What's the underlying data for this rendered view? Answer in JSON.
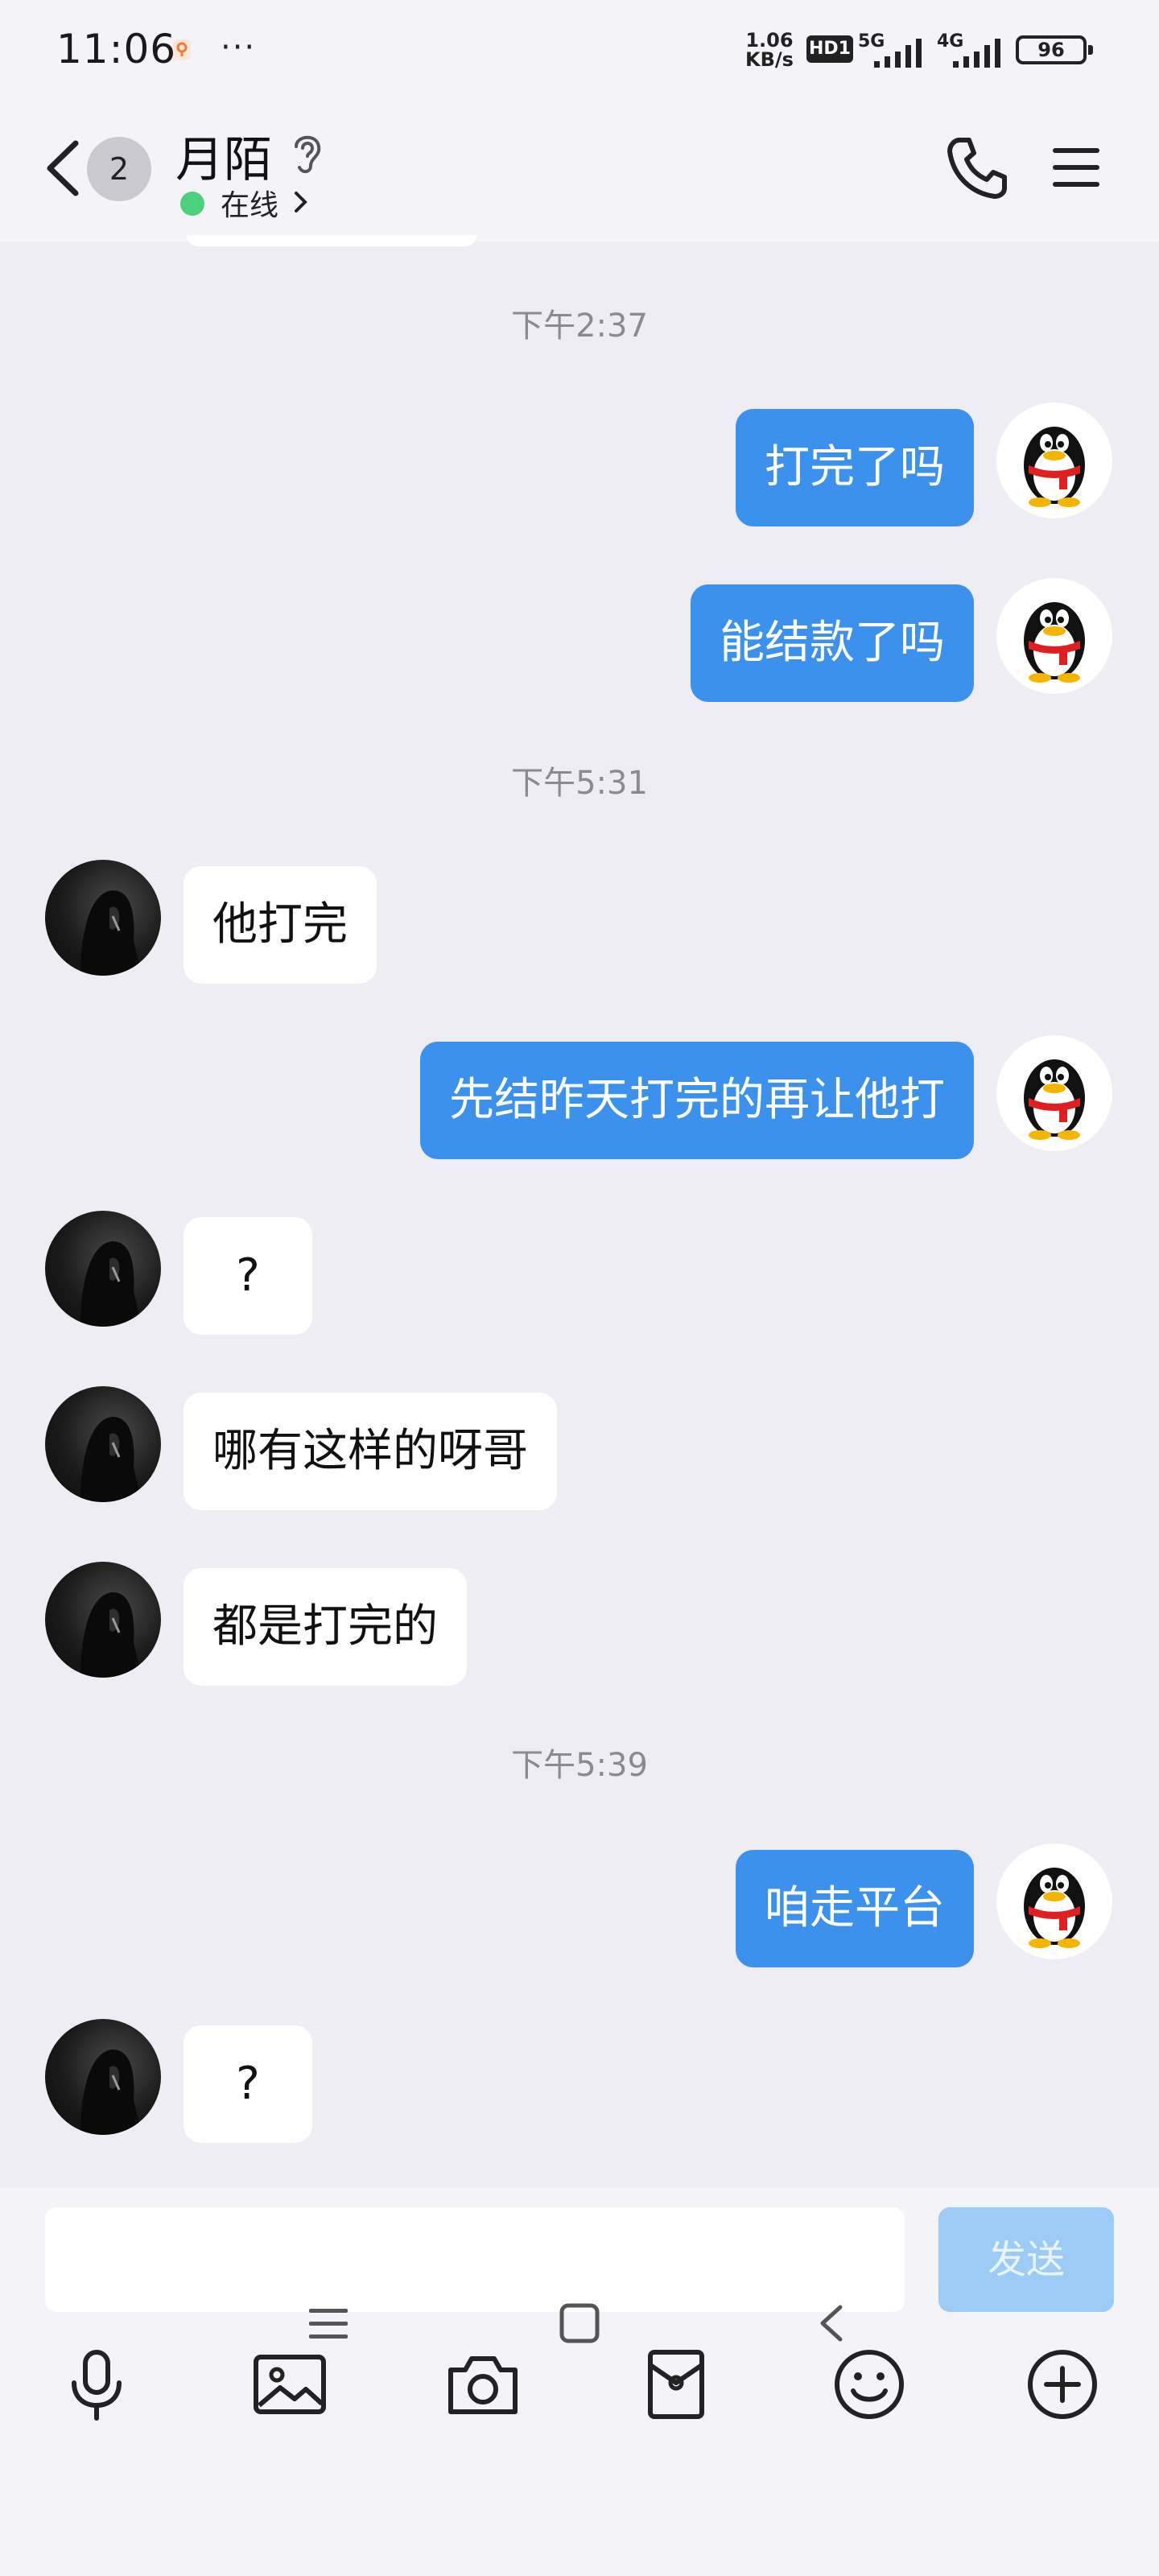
{
  "status_bar": {
    "time": "11:06",
    "dots": "···",
    "speed_top": "1.06",
    "speed_bottom": "KB/s",
    "hd_label": "HD1",
    "sig1_label": "5G",
    "sig2_label": "4G",
    "battery": "96"
  },
  "header": {
    "unread_count": "2",
    "contact_name": "月陌",
    "online_status": "在线"
  },
  "messages": {
    "t1": "下午2:37",
    "m1": "打完了吗",
    "m2": "能结款了吗",
    "t2": "下午5:31",
    "m3": "他打完",
    "m4": "先结昨天打完的再让他打",
    "m5": "?",
    "m6": "哪有这样的呀哥",
    "m7": "都是打完的",
    "t3": "下午5:39",
    "m8": "咱走平台",
    "m9": "?"
  },
  "input": {
    "value": "",
    "send_label": "发送"
  },
  "colors": {
    "accent_blue": "#3c91ec",
    "send_disabled": "#9ccbf6",
    "online_green": "#4cd07a",
    "background": "#ededf3"
  },
  "icons": {
    "toolbar": [
      "microphone-icon",
      "image-icon",
      "camera-icon",
      "red-packet-icon",
      "emoji-icon",
      "plus-icon"
    ],
    "nav": [
      "menu-nav-icon",
      "home-nav-icon",
      "back-nav-icon"
    ]
  }
}
